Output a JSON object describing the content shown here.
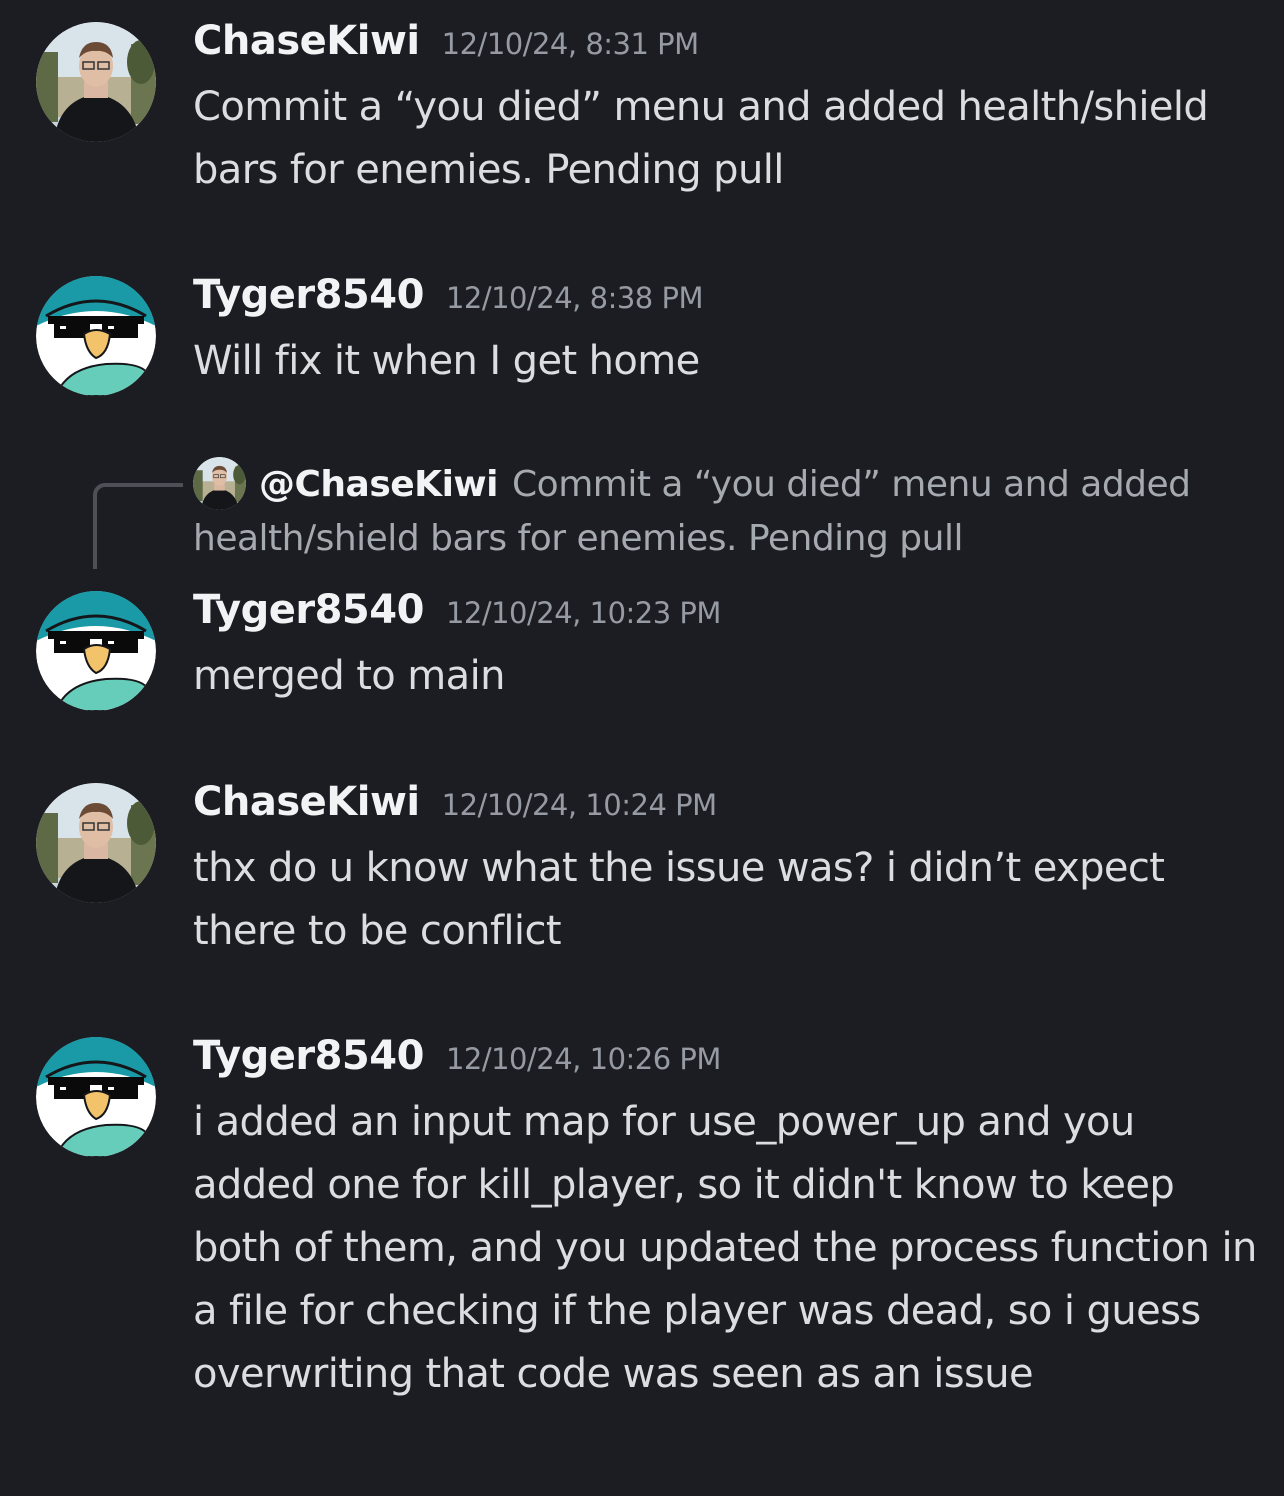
{
  "colors": {
    "background": "#1c1d22",
    "username": "#f2f3f5",
    "timestamp": "#959aa3",
    "message_text": "#dbdee1",
    "reply_text": "#a5a9b0",
    "reply_spine": "#4e5058",
    "bird_teal": "#1a9aa6",
    "bird_mint": "#66cdbb"
  },
  "messages": [
    {
      "username": "ChaseKiwi",
      "avatar_icon": "chasekiwi-avatar",
      "timestamp": "12/10/24, 8:31 PM",
      "text": "Commit a “you died” menu and added health/shield bars for enemies. Pending pull"
    },
    {
      "username": "Tyger8540",
      "avatar_icon": "tyger-avatar",
      "timestamp": "12/10/24, 8:38 PM",
      "text": "Will fix it when I get home"
    },
    {
      "username": "Tyger8540",
      "avatar_icon": "tyger-avatar",
      "timestamp": "12/10/24, 10:23 PM",
      "text": "merged to main",
      "reply": {
        "mention": "@ChaseKiwi",
        "text": "Commit a “you died” menu and added health/shield bars for enemies. Pending pull"
      }
    },
    {
      "username": "ChaseKiwi",
      "avatar_icon": "chasekiwi-avatar",
      "timestamp": "12/10/24, 10:24 PM",
      "text": "thx do u know what the issue was? i didn’t expect there to be conflict"
    },
    {
      "username": "Tyger8540",
      "avatar_icon": "tyger-avatar",
      "timestamp": "12/10/24, 10:26 PM",
      "text": "i added an input map for use_power_up and you added one for kill_player, so it didn't know to keep both of them, and you updated the process function in a file for checking if the player was dead, so i guess overwriting that code was seen as an issue"
    }
  ]
}
